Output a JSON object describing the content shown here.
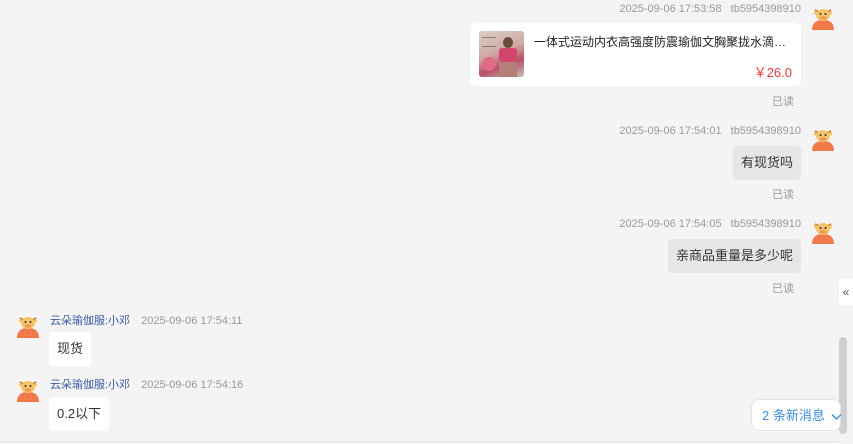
{
  "messages": [
    {
      "side": "right",
      "timestamp": "2025-09-06 17:53:58",
      "user": "tb5954398910",
      "product": {
        "title": "一体式运动内衣高强度防震瑜伽文胸聚拢水滴美背跑步健身",
        "price": "￥26.0"
      },
      "read": "已读"
    },
    {
      "side": "right",
      "timestamp": "2025-09-06 17:54:01",
      "user": "tb5954398910",
      "text": "有现货吗",
      "read": "已读"
    },
    {
      "side": "right",
      "timestamp": "2025-09-06 17:54:05",
      "user": "tb5954398910",
      "text": "亲商品重量是多少呢",
      "read": "已读"
    },
    {
      "side": "left",
      "shop": "云朵瑜伽服:小邓",
      "timestamp": "2025-09-06 17:54:11",
      "text": "现货"
    },
    {
      "side": "left",
      "shop": "云朵瑜伽服:小邓",
      "timestamp": "2025-09-06 17:54:16",
      "text": "0.2以下"
    }
  ],
  "new_messages": {
    "label": "2 条新消息",
    "icon": "chevron-down-icon"
  },
  "collapse_handle": {
    "glyph": "«",
    "icon": "double-chevron-left-icon"
  },
  "colors": {
    "background": "#f4f4f4",
    "price": "#e4393c",
    "link": "#3d8fe0",
    "shop_name": "#3b5ba5"
  }
}
